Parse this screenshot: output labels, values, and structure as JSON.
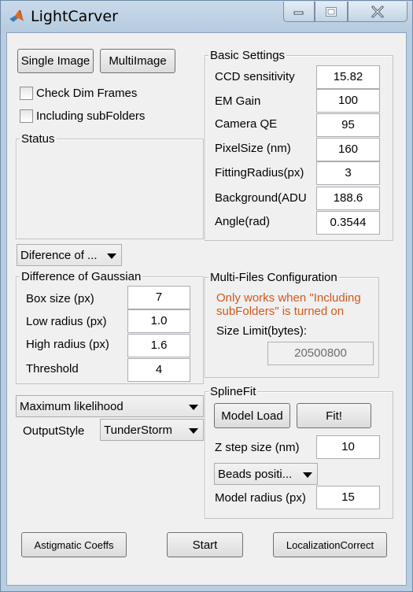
{
  "window": {
    "title": "LightCarver"
  },
  "buttons": {
    "single_image": "Single Image",
    "multi_image": "MultiImage",
    "model_load": "Model Load",
    "fit": "Fit!",
    "astigmatic": "Astigmatic Coeffs",
    "start": "Start",
    "localization_correct": "LocalizationCorrect"
  },
  "checkboxes": {
    "check_dim_frames": "Check Dim Frames",
    "including_subfolders": "Including subFolders"
  },
  "status": {
    "title": "Status"
  },
  "basic_settings": {
    "title": "Basic Settings",
    "rows": [
      {
        "label": "CCD sensitivity",
        "value": "15.82"
      },
      {
        "label": "EM Gain",
        "value": "100"
      },
      {
        "label": "Camera QE",
        "value": "95"
      },
      {
        "label": "PixelSize (nm)",
        "value": "160"
      },
      {
        "label": "FittingRadius(px)",
        "value": "3"
      },
      {
        "label": "Background(ADU",
        "value": "188.6"
      },
      {
        "label": "Angle(rad)",
        "value": "0.3544"
      }
    ]
  },
  "detection": {
    "selected": "Diference of ..."
  },
  "dog": {
    "title": "Difference of Gaussian",
    "rows": [
      {
        "label": "Box size (px)",
        "value": "7"
      },
      {
        "label": "Low radius (px)",
        "value": "1.0"
      },
      {
        "label": "High radius (px)",
        "value": "1.6"
      },
      {
        "label": "Threshold",
        "value": "4"
      }
    ]
  },
  "multifiles": {
    "title": "Multi-Files Configuration",
    "note_line1": "Only works when \"Including",
    "note_line2": "subFolders\" is turned on",
    "size_label": "Size Limit(bytes):",
    "size_value": "20500800"
  },
  "fitting": {
    "method_selected": "Maximum likelihood"
  },
  "output": {
    "label": "OutputStyle",
    "selected": "TunderStorm"
  },
  "splinefit": {
    "title": "SplineFit",
    "zstep_label": "Z step size (nm)",
    "zstep_value": "10",
    "beads_selected": "Beads positi...",
    "model_radius_label": "Model radius (px)",
    "model_radius_value": "15"
  },
  "colors": {
    "note": "#d4571c",
    "titlebar": "#b9cde2",
    "client_bg": "#f0f0f0"
  }
}
